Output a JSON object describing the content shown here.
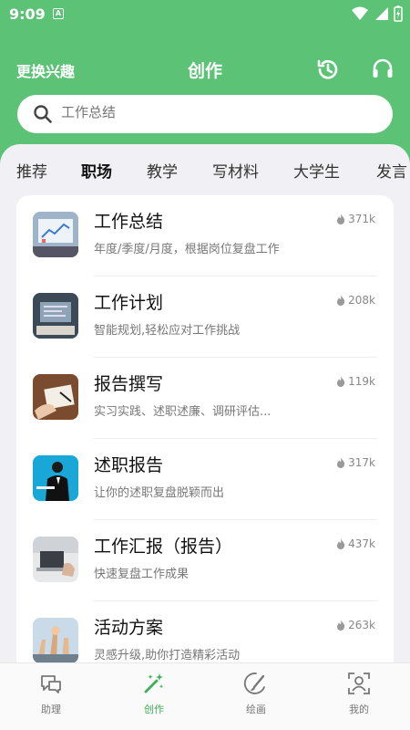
{
  "status": {
    "time": "9:09",
    "badge": "A"
  },
  "header": {
    "change_interest": "更换兴趣",
    "title": "创作"
  },
  "search": {
    "placeholder": "工作总结"
  },
  "tabs": [
    "推荐",
    "职场",
    "教学",
    "写材料",
    "大学生",
    "发言"
  ],
  "active_tab": "职场",
  "items": [
    {
      "title": "工作总结",
      "desc": "年度/季度/月度，根据岗位复盘工作",
      "count": "371k"
    },
    {
      "title": "工作计划",
      "desc": "智能规划,轻松应对工作挑战",
      "count": "208k"
    },
    {
      "title": "报告撰写",
      "desc": "实习实践、述职述廉、调研评估...",
      "count": "119k"
    },
    {
      "title": "述职报告",
      "desc": "让你的述职复盘脱颖而出",
      "count": "317k"
    },
    {
      "title": "工作汇报（报告）",
      "desc": "快速复盘工作成果",
      "count": "437k"
    },
    {
      "title": "活动方案",
      "desc": "灵感升级,助你打造精彩活动",
      "count": "263k"
    }
  ],
  "nav": [
    {
      "label": "助理",
      "icon": "chat-icon"
    },
    {
      "label": "创作",
      "icon": "magic-wand-icon"
    },
    {
      "label": "绘画",
      "icon": "paint-icon"
    },
    {
      "label": "我的",
      "icon": "profile-icon"
    }
  ],
  "active_nav": "创作",
  "colors": {
    "accent": "#5cc275",
    "nav_active": "#3fae5a"
  }
}
